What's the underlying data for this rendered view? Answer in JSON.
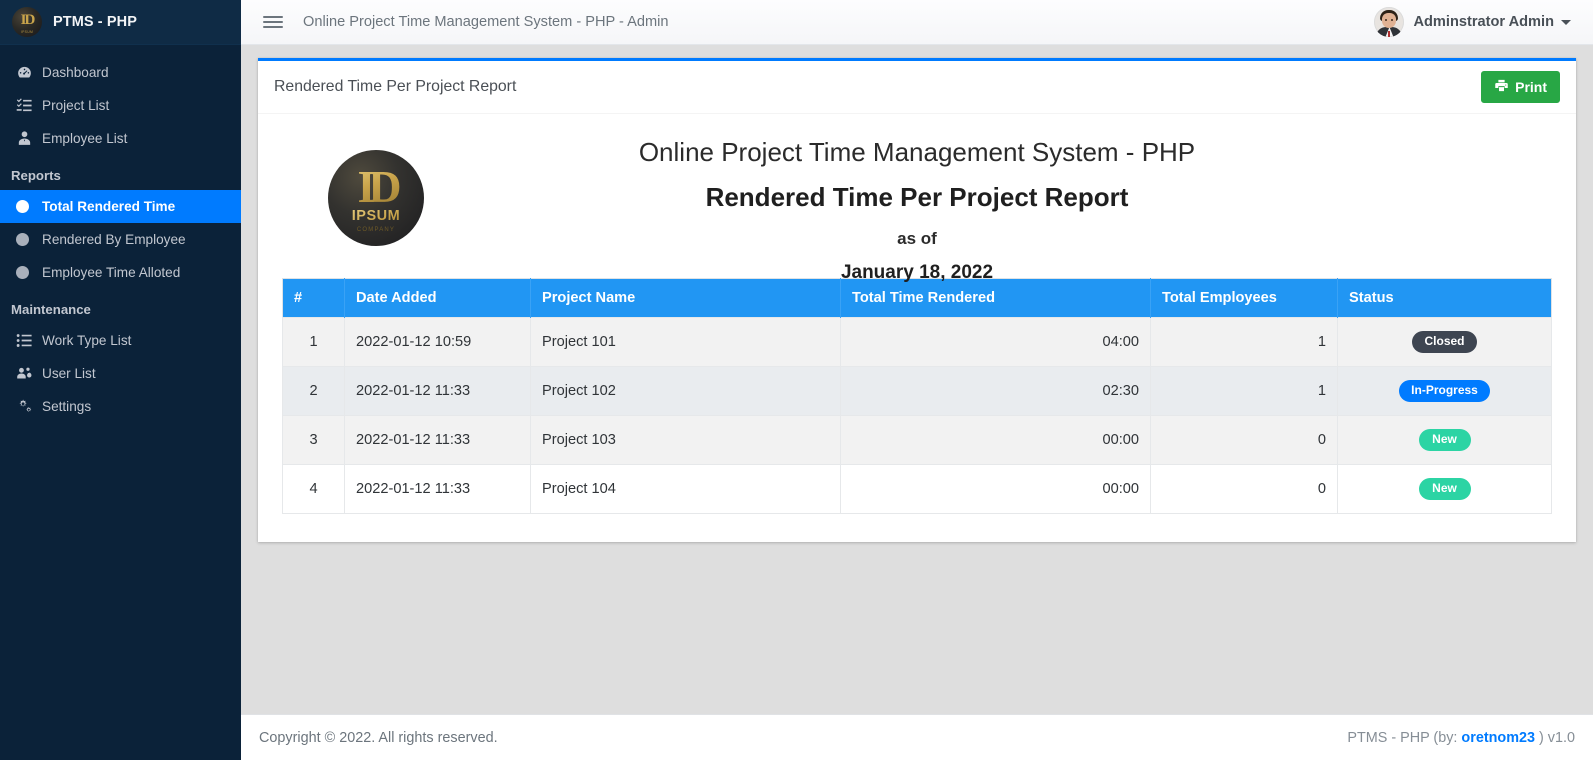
{
  "brand": {
    "name": "PTMS - PHP",
    "logo_icon": "ipsum-company-logo",
    "logo_monogram": "ID",
    "logo_wordmark": "IPSUM",
    "logo_subtext": "COMPANY"
  },
  "topbar": {
    "menu_icon": "hamburger-icon",
    "title": "Online Project Time Management System - PHP - Admin",
    "user_name": "Adminstrator Admin",
    "user_avatar_icon": "user-avatar",
    "caret_icon": "chevron-down-icon"
  },
  "sidebar": {
    "items": [
      {
        "label": "Dashboard",
        "icon": "gauge-icon",
        "active": false
      },
      {
        "label": "Project List",
        "icon": "tasks-list-icon",
        "active": false
      },
      {
        "label": "Employee List",
        "icon": "user-tie-icon",
        "active": false
      }
    ],
    "sections": [
      {
        "header": "Reports",
        "items": [
          {
            "label": "Total Rendered Time",
            "icon": "circle-icon",
            "active": true
          },
          {
            "label": "Rendered By Employee",
            "icon": "circle-icon",
            "active": false
          },
          {
            "label": "Employee Time Alloted",
            "icon": "circle-icon",
            "active": false
          }
        ]
      },
      {
        "header": "Maintenance",
        "items": [
          {
            "label": "Work Type List",
            "icon": "list-icon",
            "active": false
          },
          {
            "label": "User List",
            "icon": "users-cog-icon",
            "active": false
          },
          {
            "label": "Settings",
            "icon": "gears-icon",
            "active": false
          }
        ]
      }
    ]
  },
  "card": {
    "title": "Rendered Time Per Project Report",
    "print_label": "Print",
    "print_icon": "printer-icon",
    "accent_color": "#007bff",
    "print_color": "#28a745"
  },
  "report": {
    "system_name": "Online Project Time Management System - PHP",
    "report_name": "Rendered Time Per Project Report",
    "as_of_label": "as of",
    "as_of_date": "January 18, 2022"
  },
  "table": {
    "header_color": "#2196f3",
    "columns": [
      "#",
      "Date Added",
      "Project Name",
      "Total Time Rendered",
      "Total Employees",
      "Status"
    ],
    "rows": [
      {
        "idx": "1",
        "date": "2022-01-12 10:59",
        "project": "Project 101",
        "time": "04:00",
        "employees": "1",
        "status": "Closed",
        "status_class": "badge-closed",
        "status_color": "#3e4551"
      },
      {
        "idx": "2",
        "date": "2022-01-12 11:33",
        "project": "Project 102",
        "time": "02:30",
        "employees": "1",
        "status": "In-Progress",
        "status_class": "badge-progress",
        "status_color": "#007bff"
      },
      {
        "idx": "3",
        "date": "2022-01-12 11:33",
        "project": "Project 103",
        "time": "00:00",
        "employees": "0",
        "status": "New",
        "status_class": "badge-new",
        "status_color": "#2cd4a4"
      },
      {
        "idx": "4",
        "date": "2022-01-12 11:33",
        "project": "Project 104",
        "time": "00:00",
        "employees": "0",
        "status": "New",
        "status_class": "badge-new",
        "status_color": "#2cd4a4"
      }
    ]
  },
  "footer": {
    "copyright": "Copyright © 2022. All rights reserved.",
    "right_prefix": "PTMS - PHP (by: ",
    "right_link": "oretnom23",
    "right_suffix": " ) v1.0"
  }
}
